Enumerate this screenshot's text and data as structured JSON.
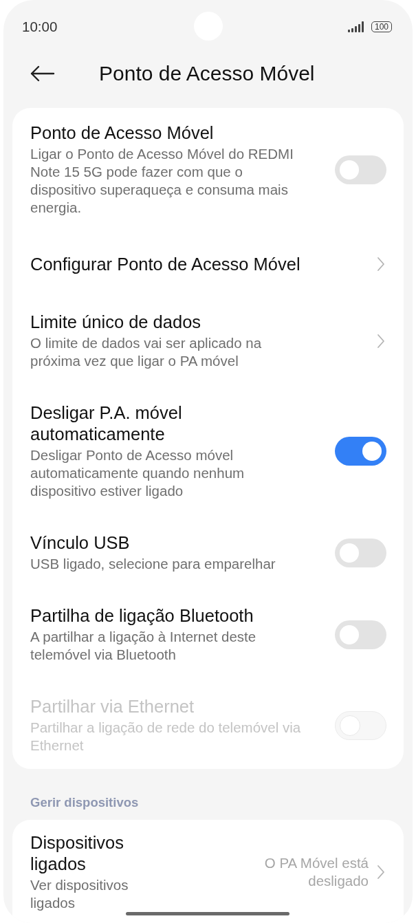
{
  "status_bar": {
    "time": "10:00",
    "battery": "100"
  },
  "header": {
    "title": "Ponto de Acesso Móvel"
  },
  "settings": [
    {
      "kind": "toggle",
      "title": "Ponto de Acesso Móvel",
      "subtitle": "Ligar o Ponto de Acesso Móvel do REDMI Note 15 5G pode fazer com que o dispositivo superaqueça e consuma mais energia.",
      "on": false,
      "disabled": false
    },
    {
      "kind": "link",
      "title": "Configurar Ponto de Acesso Móvel"
    },
    {
      "kind": "link",
      "title": "Limite único de dados",
      "subtitle": "O limite de dados vai ser aplicado na próxima vez que ligar o PA móvel"
    },
    {
      "kind": "toggle",
      "title": "Desligar P.A. móvel automaticamente",
      "subtitle": "Desligar Ponto de Acesso móvel automaticamente quando nenhum dispositivo estiver ligado",
      "on": true,
      "disabled": false
    },
    {
      "kind": "toggle",
      "title": "Vínculo USB",
      "subtitle": "USB ligado, selecione para emparelhar",
      "on": false,
      "disabled": false
    },
    {
      "kind": "toggle",
      "title": "Partilha de ligação Bluetooth",
      "subtitle": "A partilhar a ligação à Internet deste telemóvel via Bluetooth",
      "on": false,
      "disabled": false
    },
    {
      "kind": "toggle",
      "title": "Partilhar via Ethernet",
      "subtitle": "Partilhar a ligação de rede do telemóvel via Ethernet",
      "on": false,
      "disabled": true
    }
  ],
  "section": {
    "title": "Gerir dispositivos",
    "items": [
      {
        "kind": "link",
        "title": "Dispositivos ligados",
        "subtitle": "Ver dispositivos ligados",
        "value": "O PA Móvel está desligado"
      }
    ]
  }
}
